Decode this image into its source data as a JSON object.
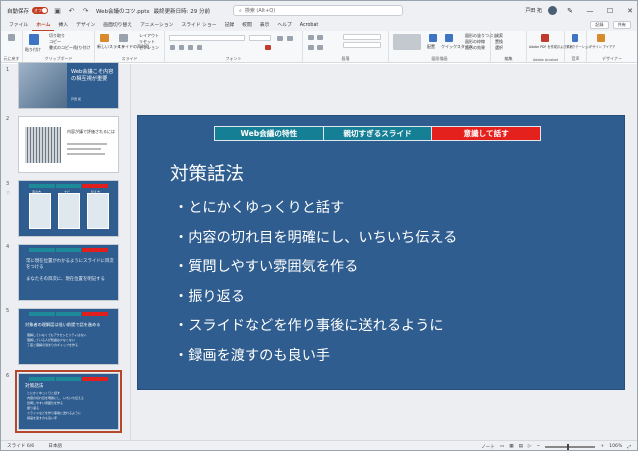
{
  "titlebar": {
    "autosave_label": "自動保存",
    "autosave_state": "オフ",
    "file_name": "Web会議のコツ.pptx",
    "saved_state": "最終更新日時: 29 分前",
    "search_placeholder": "検索 (Alt+Q)",
    "user_name": "戸田 拓"
  },
  "menu": {
    "tabs": [
      "ファイル",
      "ホーム",
      "挿入",
      "デザイン",
      "画面切り替え",
      "アニメーション",
      "スライド ショー",
      "記録",
      "校閲",
      "表示",
      "ヘルプ",
      "Acrobat"
    ],
    "active_index": 1,
    "record_button": "記録",
    "share_button": "共有"
  },
  "ribbon": {
    "groups": [
      {
        "label": "元に戻す"
      },
      {
        "label": "クリップボード",
        "items": [
          "切り取り",
          "コピー",
          "書式のコピー/貼り付け"
        ],
        "paste": "貼り付け"
      },
      {
        "label": "スライド",
        "items": [
          "新しいスライド",
          "スライドの再利用"
        ],
        "small": [
          "レイアウト",
          "リセット",
          "セクション"
        ]
      },
      {
        "label": "フォント"
      },
      {
        "label": "段落"
      },
      {
        "label": "図形描画",
        "items": [
          "配置",
          "クイックスタイル"
        ],
        "small": [
          "図形の塗りつぶし",
          "図形の枠線",
          "図形の効果"
        ]
      },
      {
        "label": "編集",
        "small": [
          "検索",
          "置換",
          "選択"
        ]
      },
      {
        "label": "Adobe Acrobat",
        "items": [
          "Adobe PDF を作成および共有"
        ]
      },
      {
        "label": "音声",
        "items": [
          "ディクテーション"
        ]
      },
      {
        "label": "デザイナー",
        "items": [
          "デザイン アイデア"
        ]
      }
    ]
  },
  "thumbnails": [
    {
      "number": "1",
      "title": "Web会議こそ内容の相互視が重要",
      "sub": "戸田 拓"
    },
    {
      "number": "2",
      "title": "内容が議で評価されるには",
      "sub": ""
    },
    {
      "number": "3",
      "cols": [
        "手の方",
        "ナビ",
        "伝え方"
      ]
    },
    {
      "number": "4",
      "lines": [
        "常に現在位置がわかるようにスライドに目次をつける",
        "まなたその目次に、現在位置を明記する"
      ]
    },
    {
      "number": "5",
      "title": "対象者の理解度は低い前提で話を進める",
      "lines": [
        "理解していなくてもアクセシビリティはない",
        "理解している人が知識は少なくない",
        "了度と理解の浅まりのギャップを作る"
      ]
    },
    {
      "number": "6",
      "title": "対策話法",
      "lines": [
        "とにかくゆっくりと話す",
        "内容の切れ目を明確にし、いちいち伝える",
        "質問しやすい雰囲気を作る",
        "振り返る",
        "スライドなどを作り事後に送れるように",
        "録画を渡すのも良い手"
      ]
    }
  ],
  "slide": {
    "header_tabs": [
      "Web会議の特性",
      "親切すぎるスライド",
      "意識して話す"
    ],
    "title": "対策話法",
    "bullets": [
      "とにかくゆっくりと話す",
      "内容の切れ目を明確にし、いちいち伝える",
      "質問しやすい雰囲気を作る",
      "振り返る",
      "スライドなどを作り事後に送れるように",
      "録画を渡すのも良い手"
    ]
  },
  "status": {
    "slide_counter": "スライド 6/6",
    "language": "日本語",
    "notes_label": "ノート",
    "zoom": "106%"
  },
  "colors": {
    "slide_bg": "#2f5d8f",
    "header_teal": "#157f95",
    "header_red": "#e5211d",
    "accent": "#b7472a"
  }
}
